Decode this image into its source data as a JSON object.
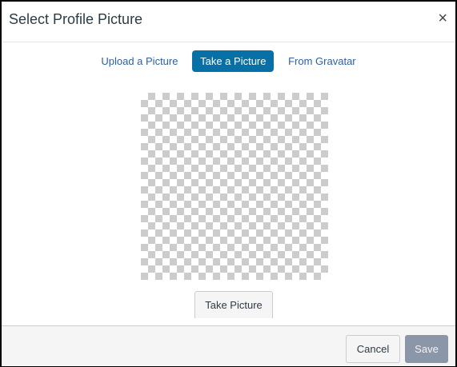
{
  "dialog": {
    "title": "Select Profile Picture",
    "close_glyph": "×"
  },
  "tabs": [
    {
      "label": "Upload a Picture",
      "active": false
    },
    {
      "label": "Take a Picture",
      "active": true
    },
    {
      "label": "From Gravatar",
      "active": false
    }
  ],
  "camera": {
    "take_button_label": "Take Picture"
  },
  "footer": {
    "cancel_label": "Cancel",
    "save_label": "Save"
  },
  "colors": {
    "active_tab": "#0770a6",
    "link": "#2b5fa6",
    "save_disabled": "#8b96a8"
  }
}
